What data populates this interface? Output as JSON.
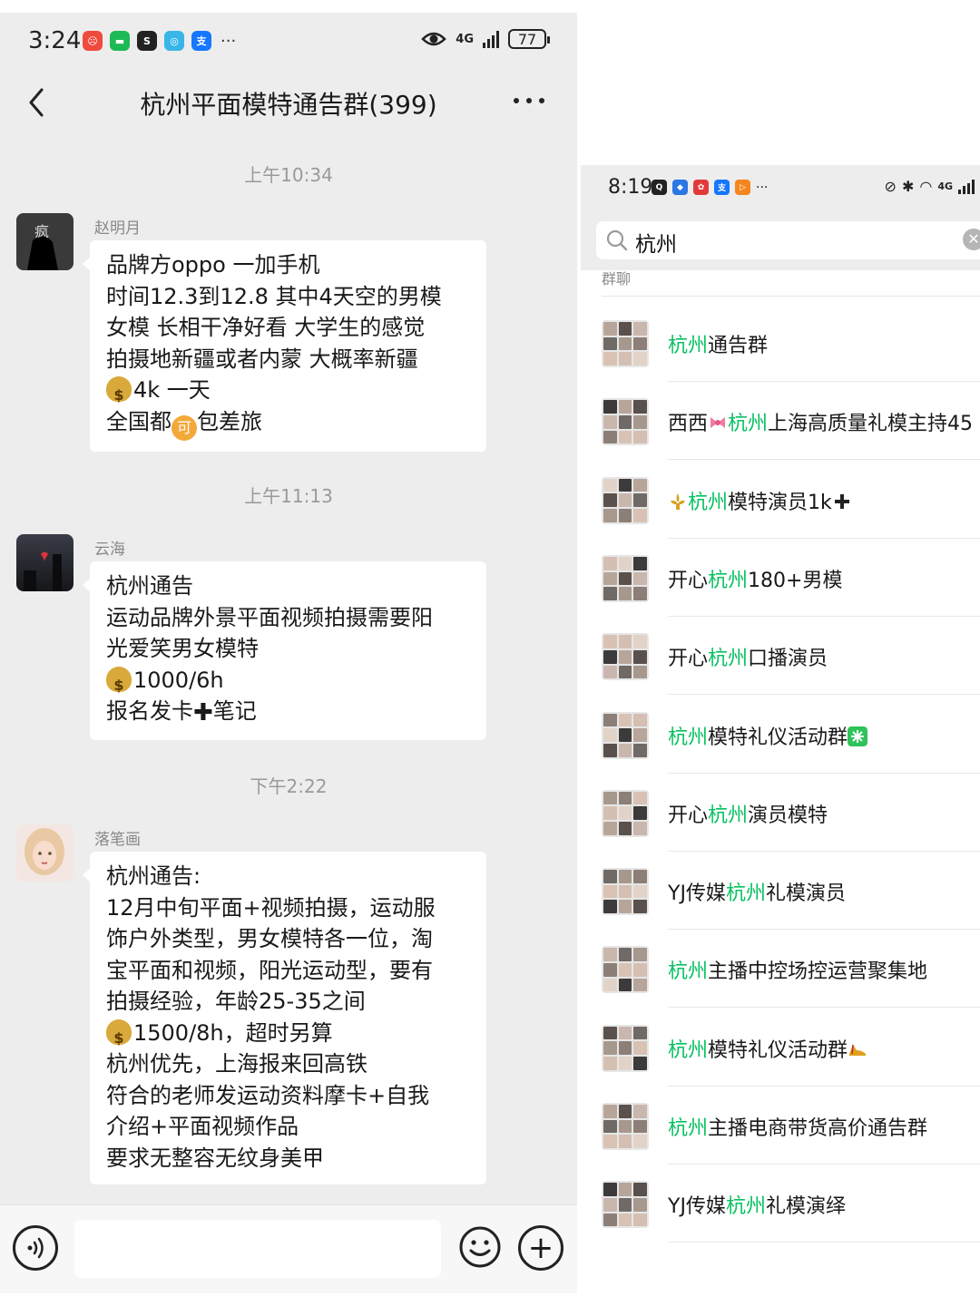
{
  "left": {
    "status": {
      "time": "3:24",
      "network": "4G",
      "battery": "77"
    },
    "title": "杭州平面模特通告群(399)",
    "messages": [
      {
        "time": "上午10:34",
        "sender": "赵明月",
        "lines": [
          "品牌方oppo 一加手机",
          "时间12.3到12.8 其中4天空的男模",
          "女模 长相干净好看 大学生的感觉",
          "拍摄地新疆或者内蒙 大概率新疆"
        ],
        "pay": "4k 一天",
        "last_a": "全国都",
        "last_icon": "可",
        "last_b": "包差旅"
      },
      {
        "time": "上午11:13",
        "sender": "云海",
        "lines": [
          "杭州通告",
          "运动品牌外景平面视频拍摄需要阳",
          "光爱笑男女模特"
        ],
        "pay": "1000/6h",
        "last_a": "报名发卡",
        "last_b": "笔记"
      },
      {
        "time": "下午2:22",
        "sender": "落笔画",
        "lines": [
          "杭州通告:",
          "12月中旬平面+视频拍摄，运动服",
          "饰户外类型，男女模特各一位，淘",
          "宝平面和视频，阳光运动型，要有",
          "拍摄经验，年龄25-35之间"
        ],
        "pay": "1500/8h，超时另算",
        "tail": [
          "杭州优先，上海报来回高铁",
          "符合的老师发运动资料摩卡+自我",
          "介绍+平面视频作品",
          "要求无整容无纹身美甲"
        ]
      }
    ]
  },
  "right": {
    "status": {
      "time": "8:19",
      "network": "4G"
    },
    "search_query": "杭州",
    "section": "群聊",
    "groups": [
      {
        "pre": "",
        "hl": "杭州",
        "post": "通告群",
        "emoji": ""
      },
      {
        "pre": "西西",
        "emoji_pre": "ribbon",
        "hl": "杭州",
        "post": "上海高质量礼模主持45",
        "emoji": ""
      },
      {
        "pre": "",
        "emoji_pre": "fleur",
        "hl": "杭州",
        "post": "模特演员1k",
        "emoji": "plus"
      },
      {
        "pre": "开心",
        "hl": "杭州",
        "post": "180+男模",
        "emoji": ""
      },
      {
        "pre": "开心",
        "hl": "杭州",
        "post": "口播演员",
        "emoji": ""
      },
      {
        "pre": "",
        "hl": "杭州",
        "post": "模特礼仪活动群",
        "emoji": "sparkle"
      },
      {
        "pre": "开心",
        "hl": "杭州",
        "post": "演员模特",
        "emoji": ""
      },
      {
        "pre": "YJ传媒",
        "hl": "杭州",
        "post": "礼模演员",
        "emoji": ""
      },
      {
        "pre": "",
        "hl": "杭州",
        "post": "主播中控场控运营聚集地",
        "emoji": ""
      },
      {
        "pre": "",
        "hl": "杭州",
        "post": "模特礼仪活动群",
        "emoji": "shoe"
      },
      {
        "pre": "",
        "hl": "杭州",
        "post": "主播电商带货高价通告群",
        "emoji": ""
      },
      {
        "pre": "YJ传媒",
        "hl": "杭州",
        "post": "礼模演绎",
        "emoji": ""
      }
    ]
  },
  "colors": {
    "wechat_green": "#07c160",
    "chat_bg": "#ededed",
    "bubble": "#ffffff"
  }
}
